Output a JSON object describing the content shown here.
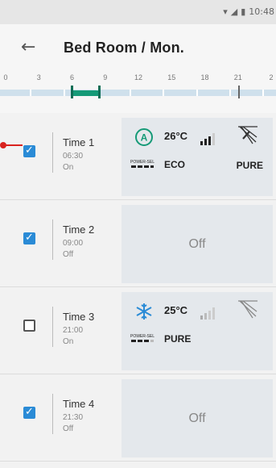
{
  "status_bar": {
    "time": "10:48",
    "icons": [
      "wifi-icon",
      "cell-signal-icon",
      "battery-icon"
    ]
  },
  "header": {
    "title": "Bed Room / Mon.",
    "back_icon": "arrow-left-icon"
  },
  "timeline": {
    "ticks": [
      "0",
      "3",
      "6",
      "9",
      "12",
      "15",
      "18",
      "21",
      "2"
    ],
    "active_segment_hours": [
      6.5,
      9
    ],
    "marker_hour": 21.5
  },
  "timers": [
    {
      "name": "Time 1",
      "time": "06:30",
      "state": "On",
      "checked": true,
      "card": {
        "off": false,
        "temp": "26°C",
        "mode_icon": "auto-mode-icon",
        "signal_icon": "fan-speed-icon",
        "swing_icon": "swing-icon",
        "powersel_icon": "power-sel-icon",
        "mode2": "ECO",
        "mode3": "PURE"
      }
    },
    {
      "name": "Time 2",
      "time": "09:00",
      "state": "Off",
      "checked": true,
      "card": {
        "off": true,
        "off_label": "Off"
      }
    },
    {
      "name": "Time 3",
      "time": "21:00",
      "state": "On",
      "checked": false,
      "card": {
        "off": false,
        "temp": "25°C",
        "mode_icon": "snowflake-icon",
        "signal_icon": "fan-speed-icon",
        "swing_icon": "swing-icon",
        "powersel_icon": "power-sel-icon",
        "mode2": "PURE",
        "mode3": ""
      }
    },
    {
      "name": "Time 4",
      "time": "21:30",
      "state": "Off",
      "checked": true,
      "card": {
        "off": true,
        "off_label": "Off"
      }
    }
  ],
  "colors": {
    "accent": "#2a8bd6",
    "segment": "#159a77",
    "track": "#cfe0ec",
    "connector": "#d9231f"
  },
  "icons": {
    "power_sel_text": "POWER-SEL"
  }
}
